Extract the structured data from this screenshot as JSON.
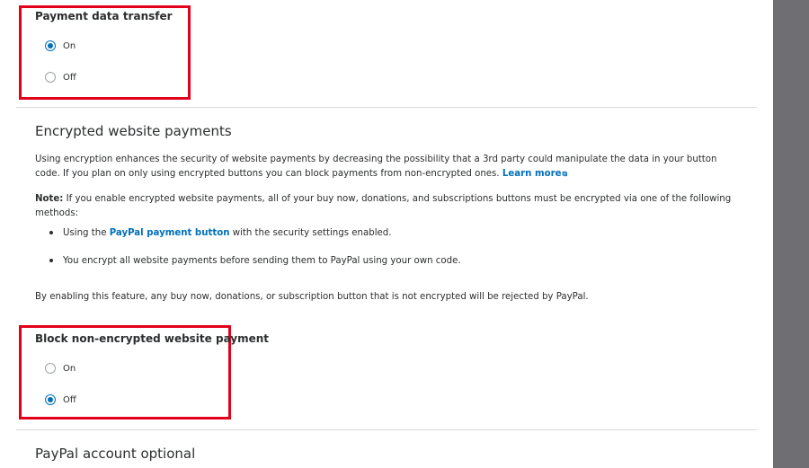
{
  "payment_data_transfer": {
    "title": "Payment data transfer",
    "options": [
      {
        "label": "On",
        "checked": true
      },
      {
        "label": "Off",
        "checked": false
      }
    ]
  },
  "encrypted": {
    "heading": "Encrypted website payments",
    "intro": "Using encryption enhances the security of website payments by decreasing the possibility that a 3rd party could manipulate the data in your button code. If you plan on only using encrypted buttons you can block payments from non-encrypted ones.",
    "learn_more": "Learn more",
    "note_label": "Note:",
    "note_text": " If you enable encrypted website payments, all of your buy now, donations, and subscriptions buttons must be encrypted via one of the following methods:",
    "bullet1_pre": "Using the ",
    "bullet1_link": "PayPal payment button",
    "bullet1_post": " with the security settings enabled.",
    "bullet2": "You encrypt all website payments before sending them to PayPal using your own code.",
    "closing": "By enabling this feature, any buy now, donations, or subscription button that is not encrypted will be rejected by PayPal."
  },
  "block_non_encrypted": {
    "title": "Block non-encrypted website payment",
    "options": [
      {
        "label": "On",
        "checked": false
      },
      {
        "label": "Off",
        "checked": true
      }
    ]
  },
  "paypal_account_optional": {
    "heading": "PayPal account optional"
  },
  "colors": {
    "accent": "#0070ba",
    "highlight": "#e3001b",
    "backdrop": "#6e6e73"
  }
}
